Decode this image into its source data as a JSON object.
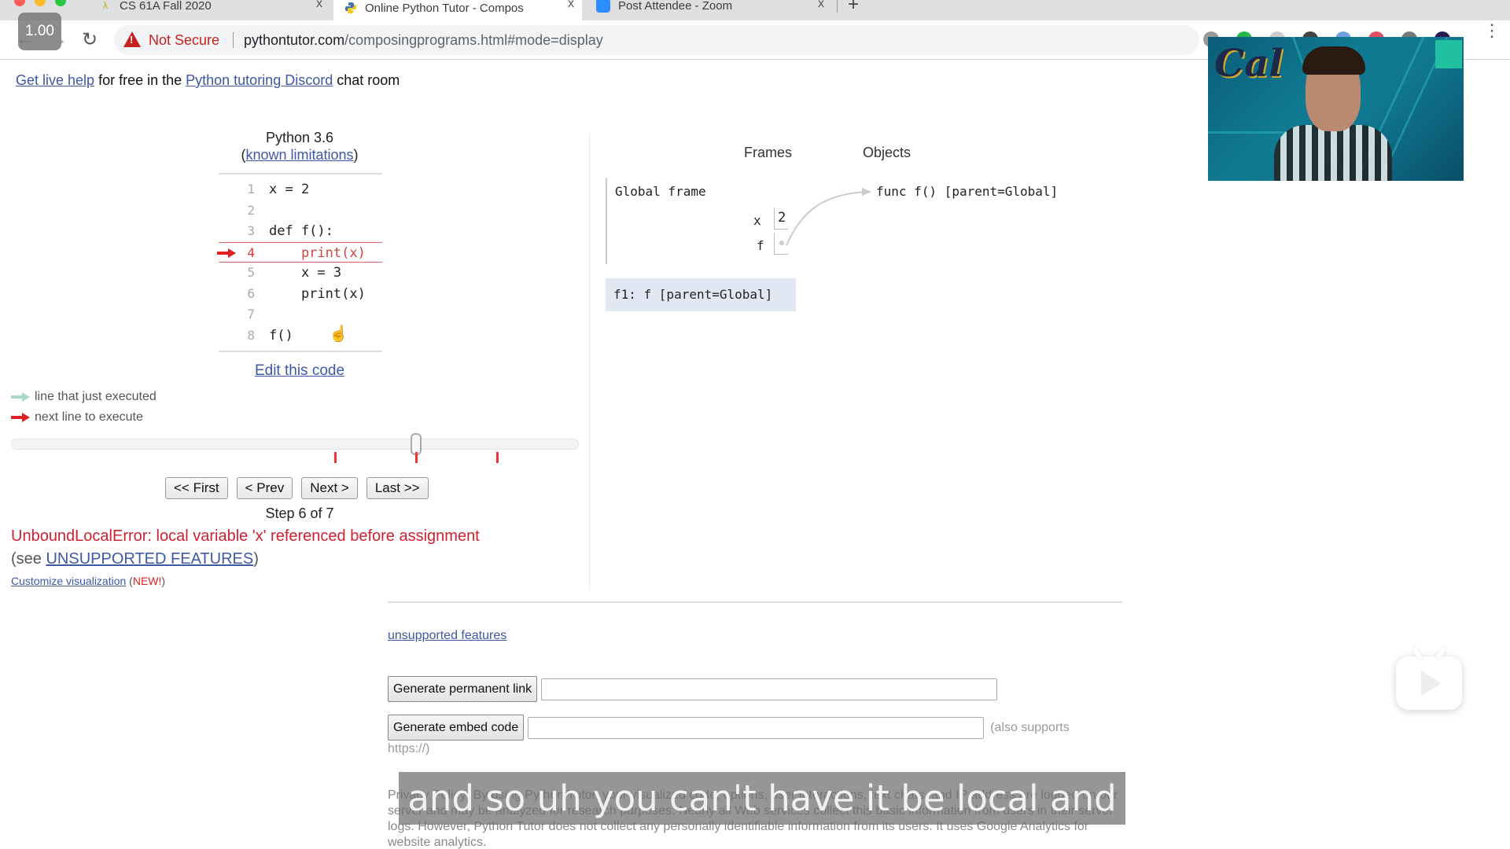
{
  "browser": {
    "tabs": [
      {
        "title": "CS 61A Fall 2020",
        "icon": "lambda-icon",
        "active": false
      },
      {
        "title": "Online Python Tutor - Compos",
        "icon": "python-icon",
        "active": true
      },
      {
        "title": "Post Attendee - Zoom",
        "icon": "zoom-icon",
        "active": false
      }
    ],
    "new_tab_symbol": "+",
    "close_symbol": "x",
    "playback_speed": "1.00",
    "security_label": "Not Secure",
    "url_host": "pythontutor.com",
    "url_path": "/composingprograms.html#mode=display"
  },
  "page": {
    "help": {
      "link1": "Get live help",
      "text1": " for free in the ",
      "link2": "Python tutoring Discord",
      "text2": " chat room"
    },
    "python_version": "Python 3.6",
    "known_limitations": "known limitations",
    "code_lines": [
      {
        "n": "1",
        "src": "x = 2"
      },
      {
        "n": "2",
        "src": ""
      },
      {
        "n": "3",
        "src": "def f():"
      },
      {
        "n": "4",
        "src": "    print(x)",
        "current": true
      },
      {
        "n": "5",
        "src": "    x = 3"
      },
      {
        "n": "6",
        "src": "    print(x)"
      },
      {
        "n": "7",
        "src": ""
      },
      {
        "n": "8",
        "src": "f()"
      }
    ],
    "edit_code": "Edit this code",
    "legend": {
      "just_executed": "line that just executed",
      "next_line": "next line to execute",
      "just_executed_color": "#a8d8c8",
      "next_line_color": "#e02020"
    },
    "slider": {
      "min": 0,
      "max": 7,
      "value": 5,
      "breakpoint_ticks": [
        4,
        5,
        6
      ]
    },
    "nav": {
      "first": "<< First",
      "prev": "< Prev",
      "next": "Next >",
      "last": "Last >>"
    },
    "step_label": "Step 6 of 7",
    "error": "UnboundLocalError: local variable 'x' referenced before assignment",
    "see": {
      "prefix": "(see ",
      "link": "UNSUPPORTED FEATURES",
      "suffix": ")"
    },
    "customize": {
      "link": "Customize visualization",
      "prefix": " (",
      "new": "NEW!",
      "suffix": ")"
    },
    "viz": {
      "frames_header": "Frames",
      "objects_header": "Objects",
      "global_frame_title": "Global frame",
      "variables": [
        {
          "name": "x",
          "value": "2"
        },
        {
          "name": "f",
          "value": "",
          "pointer": true
        }
      ],
      "func_object": "func f() [parent=Global]",
      "f1_frame": "f1: f [parent=Global]"
    },
    "unsupported_features_link": "unsupported features",
    "generate_link_button": "Generate permanent link",
    "generate_link_value": "",
    "generate_embed_button": "Generate embed code",
    "generate_embed_value": "",
    "also_supports": "(also supports",
    "https_note": "https://)",
    "privacy": "Privacy Policy: By using Python Tutor, your visualized code, options, user interactions, text chats, and IP address are logged on our server and may be analyzed for research purposes. Nearly all Web services collect this basic information from users in their server logs. However, Python Tutor does not collect any personally identifiable information from its users. It uses Google Analytics for website analytics."
  },
  "overlay": {
    "caption": "and so uh you can't have it be local and",
    "webcam_logo": "Cal"
  }
}
